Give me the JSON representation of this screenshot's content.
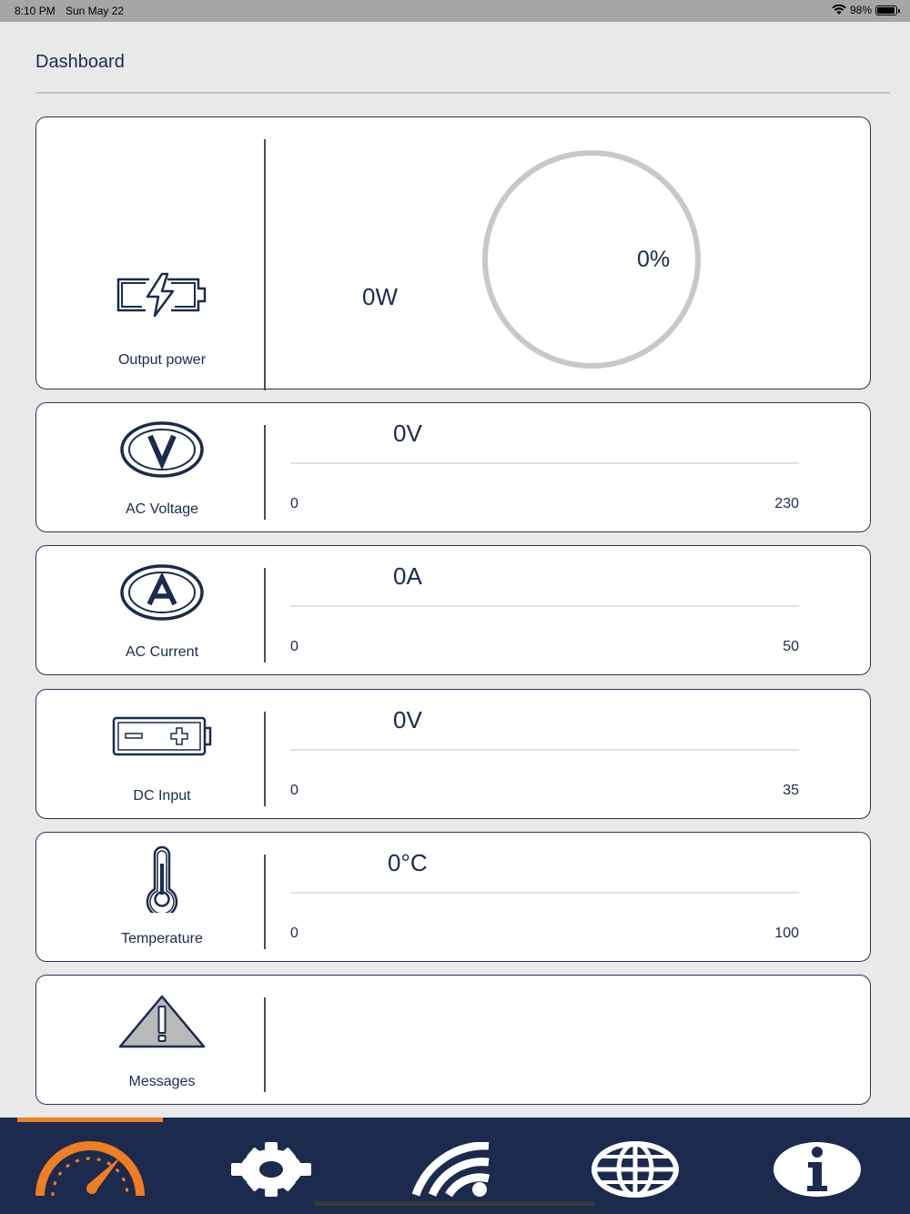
{
  "status_bar": {
    "time": "8:10 PM",
    "date": "Sun May 22",
    "battery": "98%"
  },
  "page": {
    "title": "Dashboard"
  },
  "output_power": {
    "label": "Output power",
    "value": "0W",
    "percent": "0%"
  },
  "ac_voltage": {
    "label": "AC Voltage",
    "value": "0V",
    "min": "0",
    "max": "230"
  },
  "ac_current": {
    "label": "AC Current",
    "value": "0A",
    "min": "0",
    "max": "50"
  },
  "dc_input": {
    "label": "DC Input",
    "value": "0V",
    "min": "0",
    "max": "35"
  },
  "temperature": {
    "label": "Temperature",
    "value": "0°C",
    "min": "0",
    "max": "100"
  },
  "messages": {
    "label": "Messages"
  },
  "colors": {
    "navy": "#1c2a4d",
    "accent": "#ef7d22",
    "gauge_track": "#c8c8c8"
  },
  "tabs": [
    {
      "name": "dashboard",
      "icon": "speedometer-icon",
      "active": true
    },
    {
      "name": "settings",
      "icon": "gear-icon",
      "active": false
    },
    {
      "name": "connection",
      "icon": "wifi-icon",
      "active": false
    },
    {
      "name": "web",
      "icon": "globe-icon",
      "active": false
    },
    {
      "name": "info",
      "icon": "info-icon",
      "active": false
    }
  ]
}
